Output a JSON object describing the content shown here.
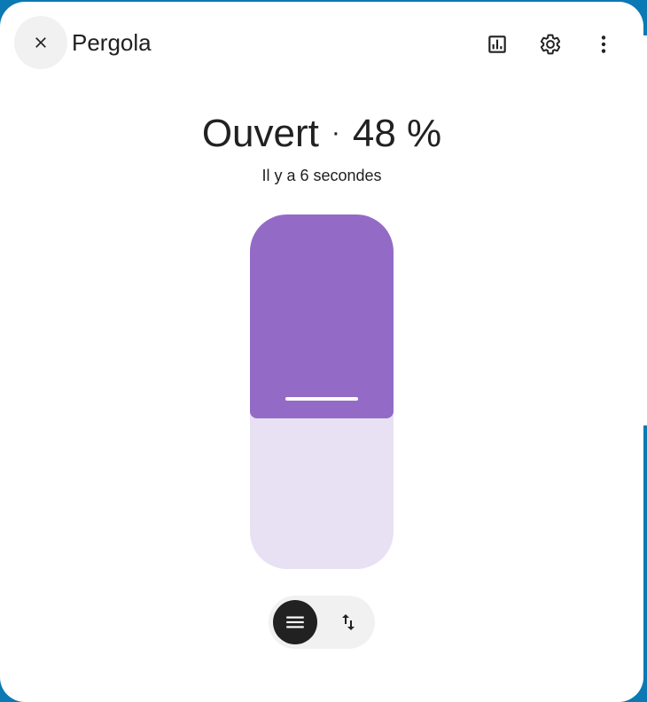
{
  "dialog": {
    "title": "Pergola",
    "icons": {
      "close": "close-icon",
      "history": "chart-icon",
      "settings": "gear-icon",
      "more": "more-vertical-icon"
    }
  },
  "state": {
    "label": "Ouvert",
    "separator": "·",
    "position": "48 %",
    "last_changed": "Il y a 6 secondes"
  },
  "slider": {
    "position_percent": 48,
    "fill_color": "#936bc6",
    "track_color": "#e8e1f3"
  },
  "mode_toggle": {
    "buttons": [
      {
        "icon": "menu-lines-icon",
        "active": true
      },
      {
        "icon": "swap-vertical-icon",
        "active": false
      }
    ]
  },
  "colors": {
    "background_page": "#0b79b3",
    "text": "#212121",
    "accent": "#936bc6"
  }
}
